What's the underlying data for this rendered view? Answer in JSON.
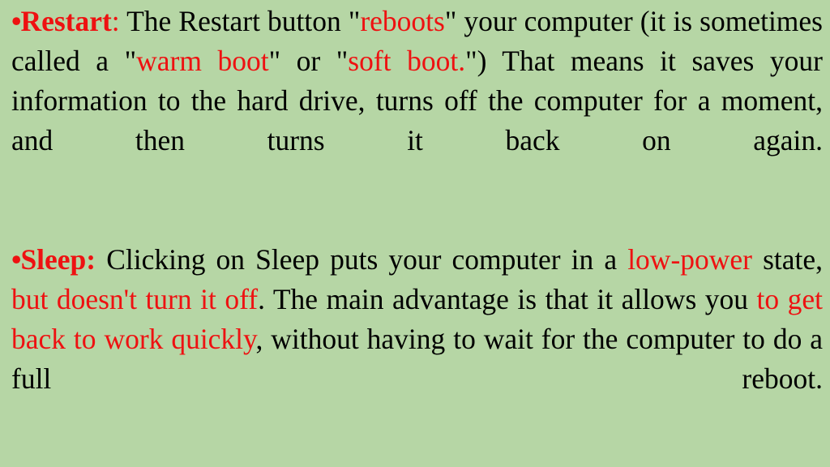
{
  "slide": {
    "background_color": "#b6d6a5",
    "text_color": "#000000",
    "accent_color": "#ee1111",
    "bullet_glyph": "•"
  },
  "paragraphs": [
    {
      "id": "restart",
      "bullet": "•",
      "heading": "Restart",
      "heading_colon": ":",
      "runs": [
        {
          "text": " The Restart button \"",
          "color": "black"
        },
        {
          "text": "reboots",
          "color": "red"
        },
        {
          "text": "\" your computer (it is sometimes called a \"",
          "color": "black"
        },
        {
          "text": "warm boot",
          "color": "red"
        },
        {
          "text": "\" or \"",
          "color": "black"
        },
        {
          "text": "soft boot.",
          "color": "red"
        },
        {
          "text": "\") That means it saves your information to the hard drive, turns off the computer for a moment, and then turns it back on again.",
          "color": "black"
        }
      ],
      "plain_text": "•Restart: The Restart button \"reboots\" your computer (it is sometimes called a \"warm boot\" or \"soft boot.\") That means it saves your information to the hard drive, turns off the computer for a moment, and then turns it back on again."
    },
    {
      "id": "sleep",
      "bullet": "•",
      "heading": "Sleep:",
      "heading_colon": "",
      "runs": [
        {
          "text": " Clicking on Sleep puts your computer in a ",
          "color": "black"
        },
        {
          "text": "low-power",
          "color": "red"
        },
        {
          "text": " state, ",
          "color": "black"
        },
        {
          "text": "but doesn't turn it off",
          "color": "red"
        },
        {
          "text": ". The main advantage is that it allows you ",
          "color": "black"
        },
        {
          "text": "to get back to work quickly",
          "color": "red"
        },
        {
          "text": ", without having to wait for the computer to do a full reboot.",
          "color": "black"
        }
      ],
      "plain_text": "•Sleep: Clicking on Sleep puts your computer in a low-power state, but doesn't turn it off. The main advantage is that it allows you to get back to work quickly, without having to wait for the computer to do a full reboot."
    }
  ]
}
